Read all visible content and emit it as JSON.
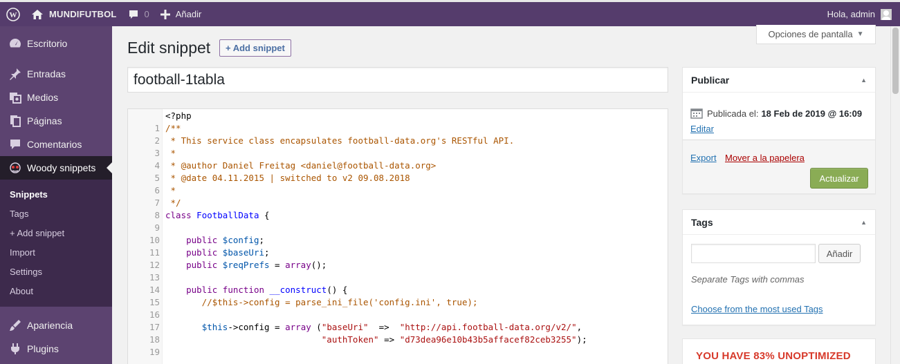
{
  "adminbar": {
    "site_name": "MUNDIFUTBOL",
    "comments_count": "0",
    "new_label": "Añadir",
    "greeting": "Hola, admin"
  },
  "sidebar": {
    "items": [
      {
        "label": "Escritorio",
        "icon": "dashboard-icon"
      },
      {
        "label": "Entradas",
        "icon": "pin-icon"
      },
      {
        "label": "Medios",
        "icon": "media-icon"
      },
      {
        "label": "Páginas",
        "icon": "pages-icon"
      },
      {
        "label": "Comentarios",
        "icon": "comment-icon"
      },
      {
        "label": "Woody snippets",
        "icon": "woody-icon"
      }
    ],
    "submenu": [
      "Snippets",
      "Tags",
      "+ Add snippet",
      "Import",
      "Settings",
      "About"
    ],
    "bottom_items": [
      {
        "label": "Apariencia",
        "icon": "brush-icon"
      },
      {
        "label": "Plugins",
        "icon": "plugin-icon"
      }
    ]
  },
  "screen_options": "Opciones de pantalla",
  "page": {
    "title": "Edit snippet",
    "add_button": "+ Add snippet",
    "snippet_title": "football-1tabla"
  },
  "editor": {
    "header": "<?php",
    "lines": [
      {
        "n": "1",
        "t": "/**"
      },
      {
        "n": "2",
        "t": " * This service class encapsulates football-data.org's RESTful API."
      },
      {
        "n": "3",
        "t": " *"
      },
      {
        "n": "4",
        "t": " * @author Daniel Freitag <daniel@football-data.org>"
      },
      {
        "n": "5",
        "t": " * @date 04.11.2015 | switched to v2 09.08.2018"
      },
      {
        "n": "6",
        "t": " *"
      },
      {
        "n": "7",
        "t": " */"
      },
      {
        "n": "8",
        "t": "class FootballData {"
      },
      {
        "n": "9",
        "t": ""
      },
      {
        "n": "10",
        "t": "    public $config;"
      },
      {
        "n": "11",
        "t": "    public $baseUri;"
      },
      {
        "n": "12",
        "t": "    public $reqPrefs = array();"
      },
      {
        "n": "13",
        "t": ""
      },
      {
        "n": "14",
        "t": "    public function __construct() {"
      },
      {
        "n": "15",
        "t": "       //$this->config = parse_ini_file('config.ini', true);"
      },
      {
        "n": "16",
        "t": ""
      },
      {
        "n": "17",
        "t": "       $this->config = array (\"baseUri\"  =>  \"http://api.football-data.org/v2/\","
      },
      {
        "n": "18",
        "t": "                              \"authToken\" => \"d73dea96e10b43b5affacef82ceb3255\");"
      },
      {
        "n": "19",
        "t": ""
      }
    ]
  },
  "publish": {
    "title": "Publicar",
    "published_label": "Publicada el:",
    "published_date": "18 Feb de 2019 @ 16:09",
    "edit_link": "Editar",
    "export_link": "Export",
    "trash_link": "Mover a la papelera",
    "update_button": "Actualizar"
  },
  "tags": {
    "title": "Tags",
    "add_button": "Añadir",
    "hint": "Separate Tags with commas",
    "choose_link": "Choose from the most used Tags"
  },
  "promo": {
    "text": "YOU HAVE 83% UNOPTIMIZED"
  },
  "colors": {
    "adminbar": "#553c6c",
    "sidebar": "#5c4370",
    "submenu": "#3d2a4c",
    "update_button": "#8aac55",
    "promo_text": "#d73a2b"
  }
}
